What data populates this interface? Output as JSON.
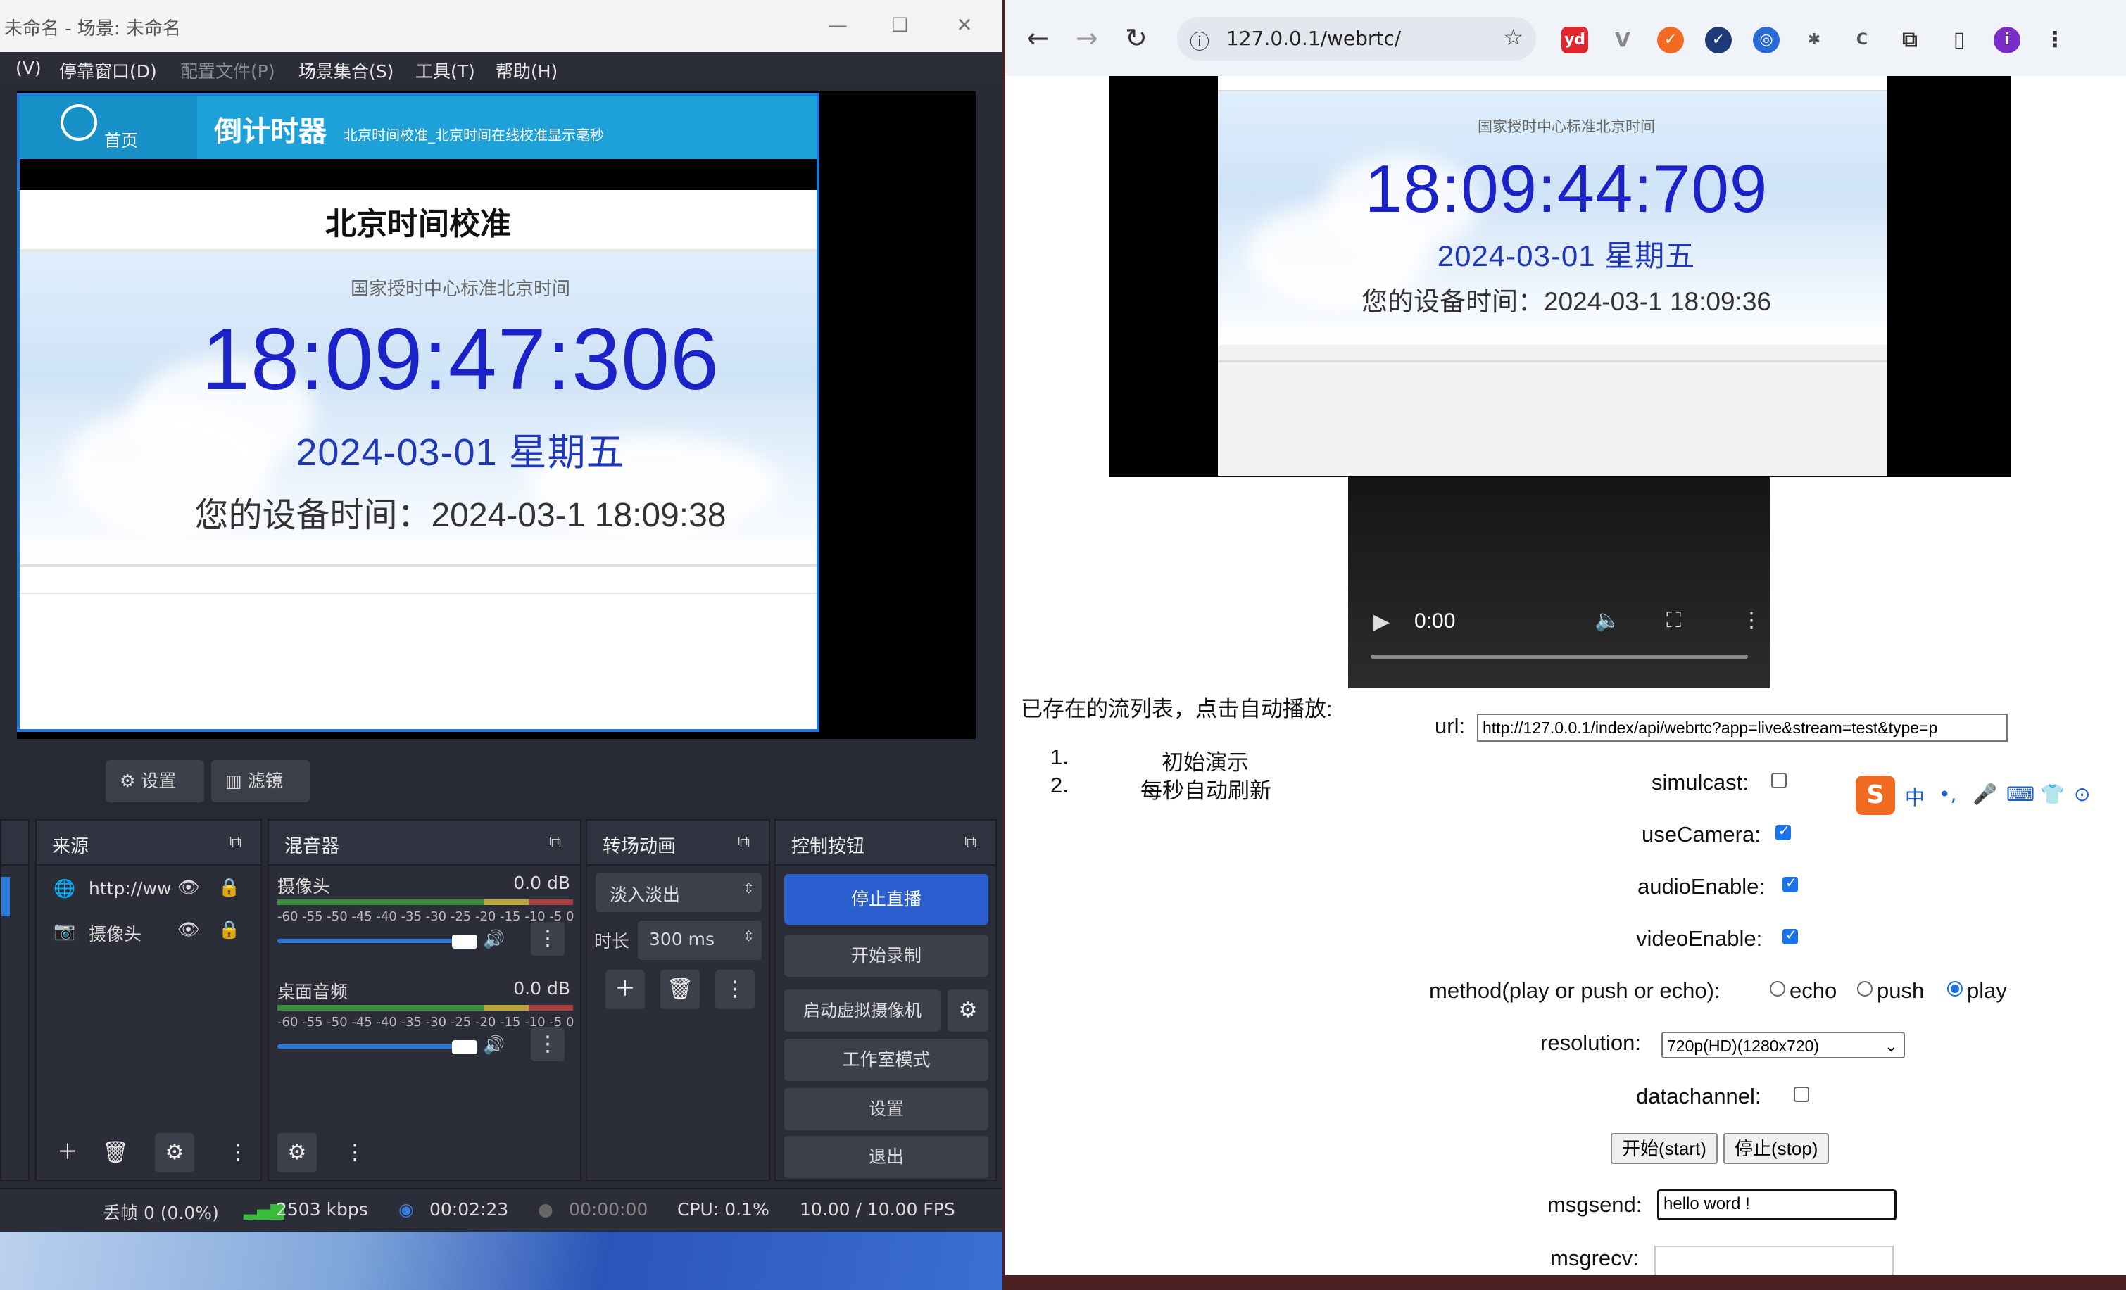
{
  "obs": {
    "title": "未命名 - 场景: 未命名",
    "menu": [
      "(V)",
      "停靠窗口(D)",
      "配置文件(P)",
      "场景集合(S)",
      "工具(T)",
      "帮助(H)"
    ],
    "preview": {
      "home_label": "首页",
      "site_title": "倒计时器",
      "site_subtitle": "北京时间校准_北京时间在线校准显示毫秒",
      "section_title": "北京时间校准",
      "caption": "国家授时中心标准北京时间",
      "time": "18:09:47:306",
      "date": "2024-03-01 星期五",
      "device_time": "您的设备时间：2024-03-1 18:09:38"
    },
    "dock_buttons": {
      "settings": "设置",
      "filters": "滤镜"
    },
    "sources": {
      "title": "来源",
      "items": [
        {
          "label": "http://ww"
        },
        {
          "label": "摄像头"
        }
      ]
    },
    "mixer": {
      "title": "混音器",
      "channels": [
        {
          "name": "摄像头",
          "db": "0.0 dB"
        },
        {
          "name": "桌面音频",
          "db": "0.0 dB"
        }
      ],
      "scale": "-60 -55 -50 -45 -40 -35 -30 -25 -20 -15 -10 -5 0",
      "level_fraction": 0.9
    },
    "transitions": {
      "title": "转场动画",
      "selected": "淡入淡出",
      "duration_label": "时长",
      "duration_value": "300 ms"
    },
    "controls": {
      "title": "控制按钮",
      "stop_stream": "停止直播",
      "start_record": "开始录制",
      "virtual_cam": "启动虚拟摄像机",
      "studio_mode": "工作室模式",
      "settings": "设置",
      "exit": "退出"
    },
    "status": {
      "dropped": "丢帧 0 (0.0%)",
      "bitrate": "2503 kbps",
      "stream_time": "00:02:23",
      "record_time": "00:00:00",
      "cpu": "CPU: 0.1%",
      "fps": "10.00 / 10.00 FPS"
    }
  },
  "chrome": {
    "url": "127.0.0.1/webrtc/",
    "video": {
      "caption": "国家授时中心标准北京时间",
      "time": "18:09:44:709",
      "date": "2024-03-01 星期五",
      "device_time": "您的设备时间：2024-03-1 18:09:36"
    },
    "player": {
      "time": "0:00"
    },
    "stream_list": {
      "heading": "已存在的流列表，点击自动播放:",
      "items": [
        "初始演示",
        "每秒自动刷新"
      ]
    },
    "form": {
      "url_label": "url:",
      "url_value": "http://127.0.0.1/index/api/webrtc?app=live&stream=test&type=p",
      "simulcast_label": "simulcast:",
      "simulcast": false,
      "usecamera_label": "useCamera:",
      "usecamera": true,
      "audio_label": "audioEnable:",
      "audio": true,
      "video_label": "videoEnable:",
      "video": true,
      "method_label": "method(play or push or echo):",
      "methods": [
        "echo",
        "push",
        "play"
      ],
      "method_selected": "play",
      "resolution_label": "resolution:",
      "resolution_value": "720p(HD)(1280x720)",
      "datachannel_label": "datachannel:",
      "datachannel": false,
      "start_button": "开始(start)",
      "stop_button": "停止(stop)",
      "msgsend_label": "msgsend:",
      "msgsend_value": "hello word !",
      "msgrecv_label": "msgrecv:"
    },
    "ime": {
      "lang": "中"
    }
  }
}
